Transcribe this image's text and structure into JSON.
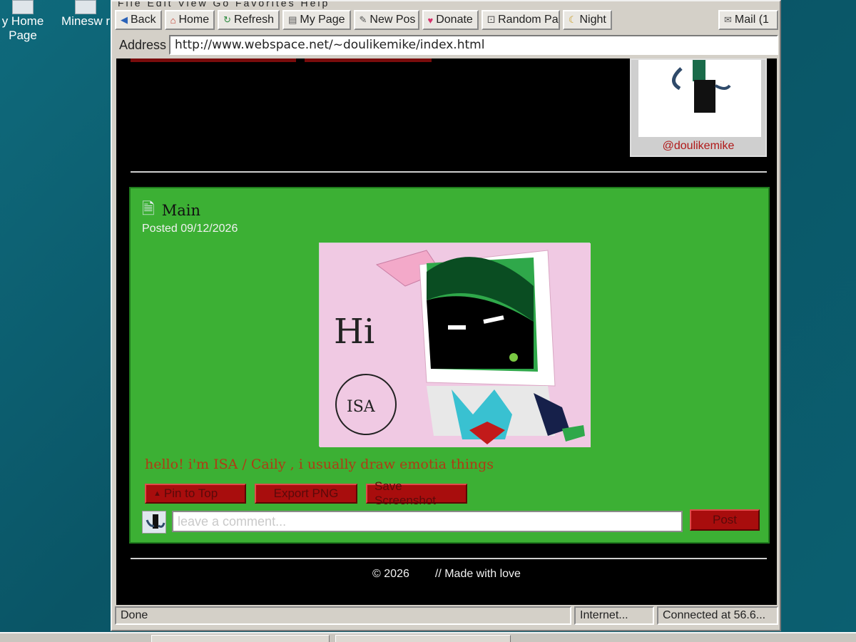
{
  "desktop": {
    "icons": [
      {
        "label": "y Home Page"
      },
      {
        "label": "Minesw r"
      }
    ]
  },
  "browser": {
    "menu": "File  Edit  View  Go  Favorites  Help",
    "toolbar": {
      "back": "Back",
      "home": "Home",
      "refresh": "Refresh",
      "my_page": "My Page",
      "new_post": "New Pos",
      "donate": "Donate",
      "random_page": "Random Pa",
      "night": "Night",
      "mail": "Mail (1"
    },
    "address": {
      "label": "Address",
      "url": "http://www.webspace.net/~doulikemike/index.html"
    },
    "status": {
      "text": "Done",
      "zone": "Internet...",
      "connection": "Connected at 56.6..."
    }
  },
  "page": {
    "profile": {
      "handle": "@doulikemike"
    },
    "post": {
      "title": "Main",
      "date": "Posted 09/12/2026",
      "text": "hello! i'm ISA / Caily , i usually draw emotia things",
      "actions": {
        "pin": "Pin to Top",
        "export": "Export PNG",
        "screenshot": "Save Screenshot"
      },
      "comment": {
        "placeholder": "leave a comment...",
        "post_label": "Post"
      },
      "image_text": {
        "hi": "Hi",
        "isa": "ISA"
      }
    },
    "footer": {
      "copyright": "© 2026",
      "made_with": "// Made with love"
    }
  },
  "colors": {
    "post_bg": "#3cb034",
    "button_red": "#a80d0d",
    "post_text": "#b03a14",
    "handle_red": "#b01818"
  }
}
